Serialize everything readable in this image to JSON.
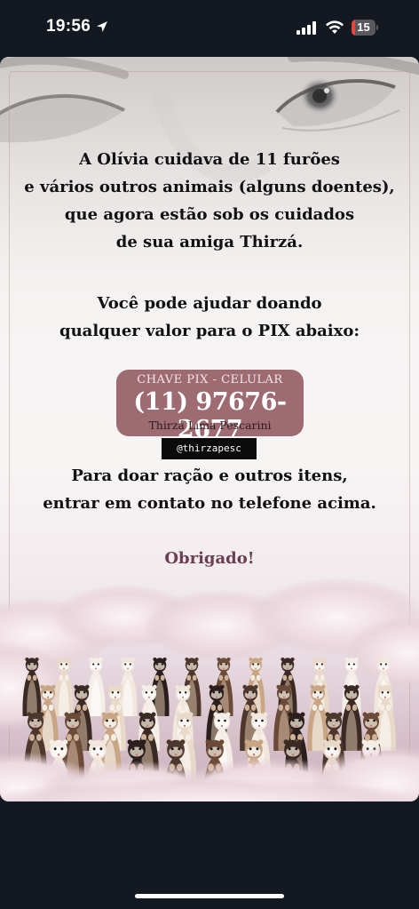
{
  "status_bar": {
    "time": "19:56",
    "battery_level": "15",
    "battery_percent": 15,
    "icons": [
      "location-arrow-icon",
      "cellular-signal-icon",
      "wifi-icon",
      "battery-icon"
    ],
    "battery_color": "#e5473d"
  },
  "story": {
    "intro_lines": [
      "A Olívia cuidava de 11 furões",
      "e vários outros animais (alguns doentes),",
      "que agora estão sob os cuidados",
      "de sua amiga Thirzá."
    ],
    "help_lines": [
      "Você pode ajudar doando",
      "qualquer valor para o PIX abaixo:"
    ],
    "pix": {
      "label": "CHAVE PIX - CELULAR",
      "number": "(11) 97676-2677",
      "name": "Thirzá Lima Pescarini",
      "box_color": "#9e6b73"
    },
    "mention": "@thirzapesc",
    "donate_lines": [
      "Para doar ração e outros itens,",
      "entrar em contato no telefone acima."
    ],
    "thanks": "Obrigado!",
    "thanks_color": "#6b3f52"
  }
}
